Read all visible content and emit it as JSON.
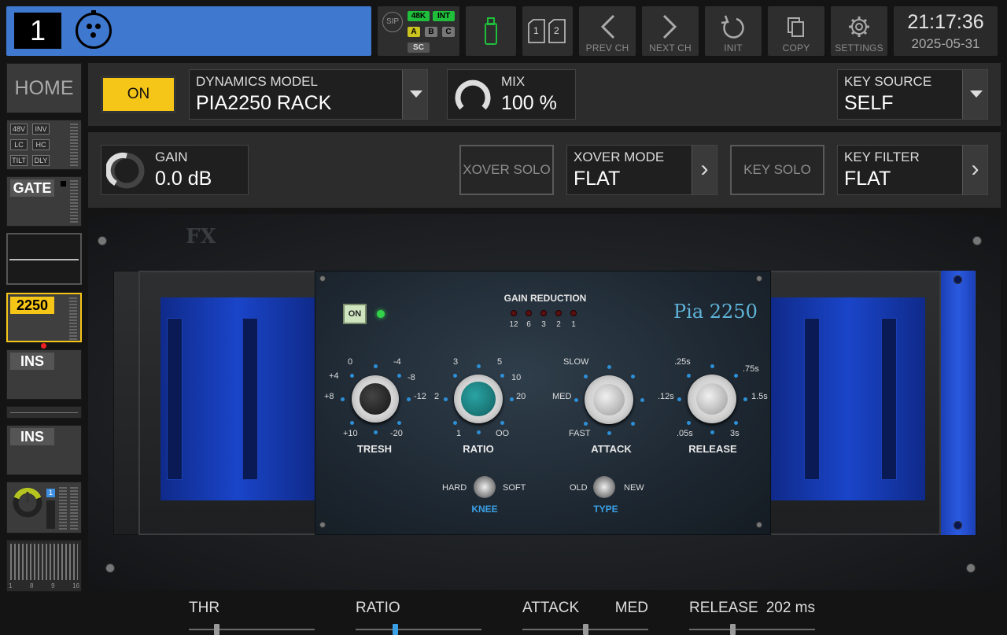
{
  "topbar": {
    "channel_number": "1",
    "sip_label": "SIP",
    "rate_48k": "48K",
    "int": "INT",
    "bus_a": "A",
    "bus_b": "B",
    "bus_c": "C",
    "sc": "SC",
    "sd1": "1",
    "sd2": "2",
    "prev_ch": "PREV CH",
    "next_ch": "NEXT CH",
    "init": "INIT",
    "copy": "COPY",
    "settings": "SETTINGS",
    "time": "21:17:36",
    "date": "2025-05-31"
  },
  "sidebar": {
    "home": "HOME",
    "minis": [
      "48V",
      "INV",
      "LC",
      "HC",
      "TILT",
      "DLY"
    ],
    "gate": "GATE",
    "dyn": "2250",
    "ins1": "INS",
    "ins2": "INS",
    "bus_index": "1",
    "meter_scale": [
      "1",
      "8",
      "9",
      "16"
    ]
  },
  "row1": {
    "on": "ON",
    "model_label": "DYNAMICS MODEL",
    "model_value": "PIA2250 RACK",
    "mix_label": "MIX",
    "mix_value": "100 %",
    "key_label": "KEY SOURCE",
    "key_value": "SELF"
  },
  "row2": {
    "gain_label": "GAIN",
    "gain_value": "0.0 dB",
    "xover_solo": "XOVER SOLO",
    "xover_mode_label": "XOVER MODE",
    "xover_mode_value": "FLAT",
    "key_solo": "KEY SOLO",
    "key_filter_label": "KEY FILTER",
    "key_filter_value": "FLAT"
  },
  "rack": {
    "fx_logo": "FX",
    "on": "ON",
    "gr_title": "GAIN REDUCTION",
    "gr_leds": [
      "12",
      "6",
      "3",
      "2",
      "1"
    ],
    "brand": "Pia 2250",
    "tresh": {
      "label": "TRESH",
      "scale": [
        "0",
        "-4",
        "+4",
        "-8",
        "+8",
        "-12",
        "+10",
        "-20"
      ]
    },
    "ratio": {
      "label": "RATIO",
      "scale": [
        "3",
        "5",
        "10",
        "2",
        "20",
        "1",
        "OO"
      ]
    },
    "attack": {
      "label": "ATTACK",
      "scale": [
        "SLOW",
        "MED",
        "FAST"
      ]
    },
    "release": {
      "label": "RELEASE",
      "scale": [
        ".25s",
        ".75s",
        ".12s",
        "1.5s",
        ".05s",
        "3s"
      ]
    },
    "knee": {
      "label": "KNEE",
      "left": "HARD",
      "right": "SOFT"
    },
    "type": {
      "label": "TYPE",
      "left": "OLD",
      "right": "NEW"
    }
  },
  "bottom": {
    "thr": {
      "name": "THR",
      "value": "",
      "level": 0.21
    },
    "ratio": {
      "name": "RATIO",
      "value": "",
      "level": 0.31
    },
    "attack": {
      "name": "ATTACK",
      "value": "MED",
      "level": 0.5
    },
    "release": {
      "name": "RELEASE",
      "value": "202 ms",
      "level": 0.34
    }
  },
  "colors": {
    "accent_blue": "#3f78cf",
    "on_yellow": "#f5c518",
    "led_green": "#33d24a",
    "teal_knob": "#1d7f7f"
  }
}
